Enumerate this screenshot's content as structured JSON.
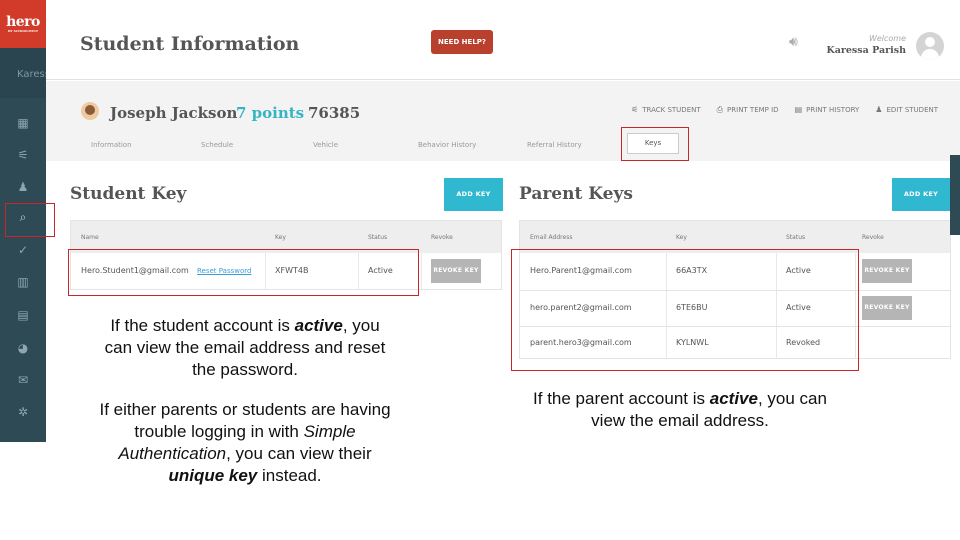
{
  "app": {
    "logo_text": "hero",
    "logo_tagline": "BY SCHOOLMINT",
    "sidebar_user": "Karess"
  },
  "sidebar": {
    "icons": [
      "dashboard-icon",
      "track-icon",
      "students-icon",
      "search-icon",
      "check-icon",
      "calendar-icon",
      "document-icon",
      "reports-icon",
      "mail-icon",
      "settings-icon"
    ]
  },
  "header": {
    "title": "Student Information",
    "help_label": "NEED HELP?",
    "welcome_label": "Welcome",
    "user_name": "Karessa Parish"
  },
  "student": {
    "name": "Joseph Jackson",
    "points": "7 points",
    "id": "76385",
    "actions": {
      "track": "TRACK STUDENT",
      "print_temp": "PRINT TEMP ID",
      "print_history": "PRINT HISTORY",
      "edit": "EDIT STUDENT"
    },
    "tabs": {
      "information": "Information",
      "schedule": "Schedule",
      "vehicle": "Vehicle",
      "behavior": "Behavior History",
      "referral": "Referral History",
      "keys": "Keys"
    }
  },
  "student_key": {
    "title": "Student Key",
    "add_label": "ADD KEY",
    "headers": {
      "name": "Name",
      "key": "Key",
      "status": "Status",
      "revoke": "Revoke"
    },
    "row": {
      "email": "Hero.Student1@gmail.com",
      "reset_label": "Reset Password",
      "key": "XFWT4B",
      "status": "Active",
      "revoke_label": "REVOKE KEY"
    }
  },
  "parent_keys": {
    "title": "Parent Keys",
    "add_label": "ADD KEY",
    "headers": {
      "email": "Email Address",
      "key": "Key",
      "status": "Status",
      "revoke": "Revoke"
    },
    "rows": [
      {
        "email": "Hero.Parent1@gmail.com",
        "key": "66A3TX",
        "status": "Active",
        "revoke_label": "REVOKE KEY"
      },
      {
        "email": "hero.parent2@gmail.com",
        "key": "6TE6BU",
        "status": "Active",
        "revoke_label": "REVOKE KEY"
      },
      {
        "email": "parent.hero3@gmail.com",
        "key": "KYLNWL",
        "status": "Revoked"
      }
    ]
  },
  "captions": {
    "student_p1_a": "If the student account is ",
    "student_p1_b": "active",
    "student_p1_c": ", you can view the email address and reset the password.",
    "student_p2_a": "If either parents or students are having trouble logging in with ",
    "student_p2_b": "Simple Authentication",
    "student_p2_c": ", you can view their ",
    "student_p2_d": "unique key",
    "student_p2_e": " instead.",
    "parent_a": "If the parent account is ",
    "parent_b": "active",
    "parent_c": ", you can view the email address."
  },
  "colors": {
    "sidebar": "#2d4a55",
    "logo": "#d23a2a",
    "help_button": "#b8402d",
    "accent": "#30b8d0",
    "points": "#35b5c4",
    "annotation": "#c8262a"
  }
}
